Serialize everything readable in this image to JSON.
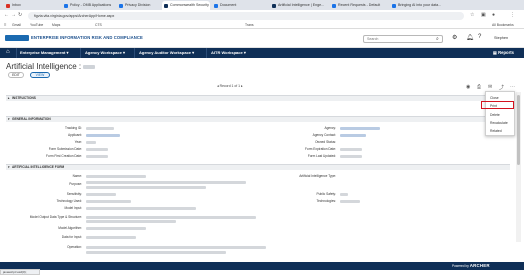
{
  "browser": {
    "tabs": [
      {
        "label": "Inbox",
        "color": "#d93025"
      },
      {
        "label": "Policy - OMB Applications",
        "color": "#1a73e8"
      },
      {
        "label": "Privacy Division",
        "color": "#1a73e8"
      },
      {
        "label": "Commonwealth Security and",
        "color": "#0f2f57"
      },
      {
        "label": "Document",
        "color": "#1a73e8"
      },
      {
        "label": "Artificial Intelligence | Enge...",
        "color": "#0f2f57"
      },
      {
        "label": "Recent Requests - Default",
        "color": "#1a73e8"
      },
      {
        "label": "Bringing AI into your data...",
        "color": "#1a73e8"
      }
    ],
    "url": "figvta.vita.virginia.gov/apps/ArcherApp/Home.aspx",
    "bookmarks": [
      "Gmail",
      "YouTube",
      "Maps",
      "CTS",
      "",
      "",
      "",
      "",
      "",
      "",
      "",
      "Trans",
      "All Bookmarks"
    ]
  },
  "app": {
    "logo_text": "ENTERPRISE INFORMATION RISK AND COMPLIANCE",
    "search_placeholder": "Search",
    "user_name": "Stephen"
  },
  "nav": {
    "items": [
      "Enterprise Management ▾",
      "Agency Workspace ▾",
      "Agency Auditor Workspace ▾",
      "AITR Workspace ▾"
    ],
    "reports_label": "Reports"
  },
  "page": {
    "title": "Artificial Intelligence :",
    "edit_label": "EDIT",
    "view_label": "VIEW",
    "pager": "◂   Record 1 of 1   ▸"
  },
  "sections": {
    "instructions": "INSTRUCTIONS",
    "general": "GENERAL INFORMATION",
    "ai_use_case": "ARTIFICIAL INTELLIGENCE FORM"
  },
  "general_fields": {
    "left": [
      "Tracking ID:",
      "Applicant:",
      "Year:",
      "Form Submission Date:",
      "Form First Creation Date:"
    ],
    "right": [
      "Agency:",
      "Agency Contact:",
      "Owned Status:",
      "Form Expiration Date:",
      "Form Last Updated:"
    ]
  },
  "ai_fields": {
    "left": [
      "Name:",
      "Purpose:",
      "Sensitivity:",
      "Technology Used:",
      "Model Input:",
      "Model Output Data Type & Structure:",
      "Model Algorithm:",
      "Data for Input:",
      "Operation:"
    ],
    "right": [
      "Artificial Intelligence Type:",
      "Public Safety:",
      "Technologies:"
    ]
  },
  "menu": {
    "items": [
      "Close",
      "Print",
      "Delete",
      "Recalculate",
      "Related"
    ]
  },
  "footer": {
    "powered_prefix": "Powered by",
    "powered_brand": "ARCHER"
  },
  "statusbar": "javascript:void(0);",
  "icons": {
    "home": "home-icon",
    "search": "search-icon",
    "settings": "gear-icon",
    "notifications": "bell-icon",
    "help": "help-icon",
    "reports": "reports-icon"
  }
}
